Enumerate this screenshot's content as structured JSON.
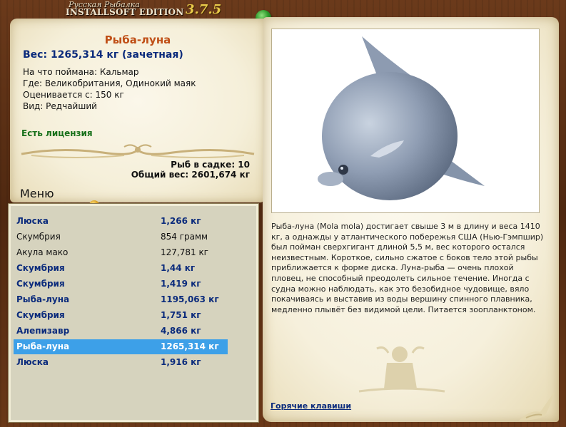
{
  "app": {
    "logo_small": "Русская Рыбалка",
    "logo_big": "INSTALLSOFT EDITION",
    "version": "3.7.5"
  },
  "fish": {
    "name": "Рыба-луна",
    "weight": "Вес: 1265,314 кг (зачетная)",
    "bait": "На что поймана: Кальмар",
    "place": "Где: Великобритания, Одинокий маяк",
    "value": "Оценивается с: 150 кг",
    "kind": "Вид: Редчайший",
    "license": "Есть лицензия"
  },
  "catch": {
    "count": "Рыб в садке: 10",
    "total": "Общий вес: 2601,674 кг"
  },
  "menu": {
    "title": "Меню"
  },
  "list": [
    {
      "name": "Люска",
      "weight": "1,266 кг",
      "bold": true,
      "selected": false
    },
    {
      "name": "Скумбрия",
      "weight": "854 грамм",
      "bold": false,
      "selected": false
    },
    {
      "name": "Акула мако",
      "weight": "127,781 кг",
      "bold": false,
      "selected": false
    },
    {
      "name": "Скумбрия",
      "weight": "1,44 кг",
      "bold": true,
      "selected": false
    },
    {
      "name": "Скумбрия",
      "weight": "1,419 кг",
      "bold": true,
      "selected": false
    },
    {
      "name": "Рыба-луна",
      "weight": "1195,063 кг",
      "bold": true,
      "selected": false
    },
    {
      "name": "Скумбрия",
      "weight": "1,751 кг",
      "bold": true,
      "selected": false
    },
    {
      "name": "Алепизавр",
      "weight": "4,866 кг",
      "bold": true,
      "selected": false
    },
    {
      "name": "Рыба-луна",
      "weight": "1265,314 кг",
      "bold": true,
      "selected": true
    },
    {
      "name": "Люска",
      "weight": "1,916 кг",
      "bold": true,
      "selected": false
    }
  ],
  "description": "Рыба-луна (Mola mola) достигает свыше 3 м в длину и веса 1410 кг, а однажды у атлантического побережья США (Нью-Гэмпшир) был пойман сверхгигант длиной 5,5 м, вес которого остался неизвестным. Короткое, сильно сжатое с боков тело этой рыбы приближается к форме диска. Луна-рыба — очень плохой пловец, не способный преодолеть сильное течение. Иногда с судна можно наблюдать, как это безобидное чудовище, вяло покачиваясь и выставив из воды вершину спинного плавника, медленно плывёт без видимой цели. Питается зоопланктоном.",
  "hotkeys_link": "Горячие клавиши",
  "colors": {
    "wood": "#5a2f15",
    "parchment": "#f6f0dc",
    "name_orange": "#c05018",
    "weight_blue": "#0b2b7c",
    "license_green": "#17701a",
    "selection": "#3da0e8",
    "list_bg": "#d6d3be"
  }
}
